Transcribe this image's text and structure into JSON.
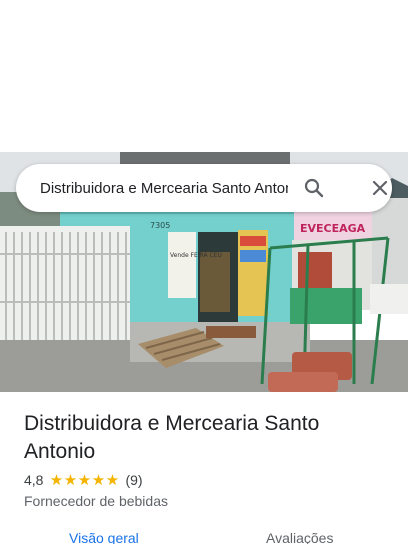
{
  "search": {
    "value": "Distribuidora e Mercearia Santo Antonio"
  },
  "place": {
    "title": "Distribuidora e Mercearia Santo Antonio",
    "rating": "4,8",
    "stars": 5,
    "reviews_count": "(9)",
    "category": "Fornecedor de bebidas"
  },
  "photo_signs": {
    "store_sign": "EVECEAGA",
    "house_number": "7305",
    "window_note": "Vende FEIRA CEU"
  },
  "tabs": [
    {
      "label": "Visão geral"
    },
    {
      "label": "Avaliações"
    }
  ],
  "colors": {
    "accent": "#1a73e8",
    "star": "#f4b400"
  },
  "icons": {
    "search": "search-icon",
    "close": "close-icon"
  }
}
